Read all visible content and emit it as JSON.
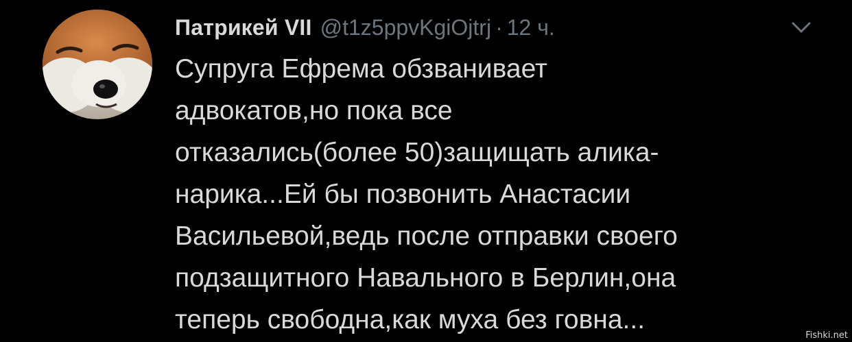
{
  "tweet": {
    "display_name": "Патрикей VII",
    "handle": "@t1z5ppvKgiOjtrj",
    "separator": "·",
    "time": "12 ч.",
    "avatar_icon": "fox-avatar",
    "menu_icon": "chevron-down-icon",
    "text_lines": [
      "Супруга Ефрема обзванивает",
      "адвокатов,но пока все",
      "отказались(более 50)защищать алика-",
      "нарика...Ей бы позвонить Анастасии",
      "Васильевой,ведь после отправки своего",
      "подзащитного Навального в Берлин,она",
      "теперь свободна,как муха без говна..."
    ]
  },
  "watermark": "Fishki.net",
  "colors": {
    "background": "#000000",
    "text": "#d9d9d9",
    "secondary": "#6e767d"
  }
}
